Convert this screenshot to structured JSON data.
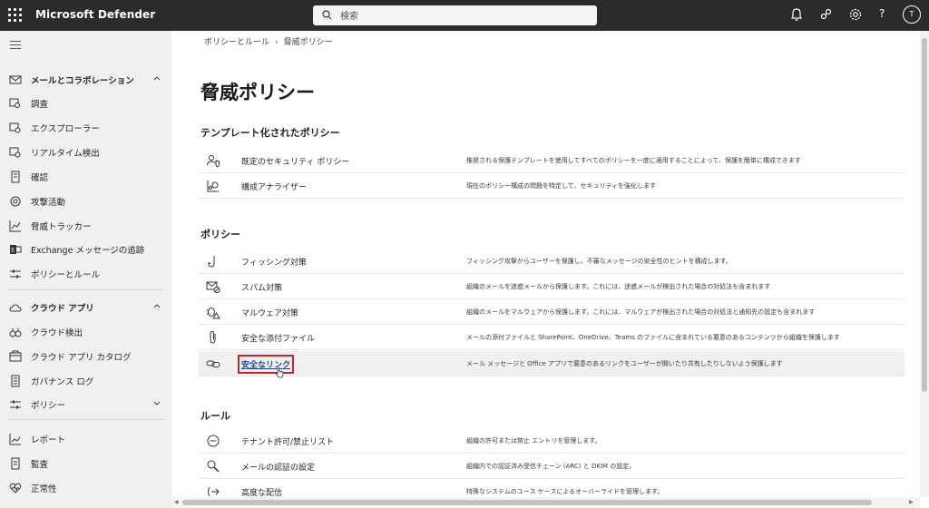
{
  "app": {
    "title": "Microsoft Defender",
    "search_placeholder": "検索",
    "avatar_initial": "T",
    "help_label": "?"
  },
  "sidebar": {
    "groups": [
      {
        "label": "メールとコラボレーション",
        "expanded": true,
        "items": [
          "調査",
          "エクスプローラー",
          "リアルタイム検出",
          "確認",
          "攻撃活動",
          "脅威トラッカー",
          "Exchange メッセージの追跡",
          "ポリシーとルール"
        ]
      },
      {
        "label": "クラウド アプリ",
        "expanded": true,
        "items": [
          "クラウド検出",
          "クラウド アプリ カタログ",
          "ガバナンス ログ",
          "ポリシー"
        ]
      }
    ],
    "bottom_items": [
      "レポート",
      "監査",
      "正常性"
    ]
  },
  "breadcrumb": [
    "ポリシーとルール",
    "脅威ポリシー"
  ],
  "page_title": "脅威ポリシー",
  "sections": [
    {
      "heading": "テンプレート化されたポリシー",
      "rows": [
        {
          "icon": "people-shield-icon",
          "name": "既定のセキュリティ ポリシー",
          "desc": "推奨される保護テンプレートを使用してすべてのポリシーを一度に適用することによって、保護を簡単に構成できます"
        },
        {
          "icon": "analyzer-icon",
          "name": "構成アナライザー",
          "desc": "現在のポリシー構成の問題を特定して、セキュリティを強化します"
        }
      ]
    },
    {
      "heading": "ポリシー",
      "rows": [
        {
          "icon": "fishhook-icon",
          "name": "フィッシング対策",
          "desc": "フィッシング攻撃からユーザーを保護し、不審なメッセージの安全性のヒントを構成します。"
        },
        {
          "icon": "mail-block-icon",
          "name": "スパム対策",
          "desc": "組織のメールを迷惑メールから保護します。これには、迷惑メールが検出された場合の対処法も含まれます"
        },
        {
          "icon": "bug-warning-icon",
          "name": "マルウェア対策",
          "desc": "組織のメールをマルウェアから保護します。これには、マルウェアが検出された場合の対処法と通知先の設定も含まれます"
        },
        {
          "icon": "paperclip-icon",
          "name": "安全な添付ファイル",
          "desc": "メールの添付ファイルと SharePoint、OneDrive、Teams のファイルに含まれている悪意のあるコンテンツから組織を保護します"
        },
        {
          "icon": "link-icon",
          "name": "安全なリンク",
          "desc": "メール メッセージと Office アプリで悪意のあるリンクをユーザーが開いたり共有したりしないよう保護します",
          "highlighted": true
        }
      ]
    },
    {
      "heading": "ルール",
      "rows": [
        {
          "icon": "block-circle-icon",
          "name": "テナント許可/禁止リスト",
          "desc": "組織の許可または禁止 エントリを管理します。"
        },
        {
          "icon": "key-search-icon",
          "name": "メールの認証の設定",
          "desc": "組織内での認証済み受信チェーン (ARC) と DKIM の設定。"
        },
        {
          "icon": "advanced-delivery-icon",
          "name": "高度な配信",
          "desc": "特殊なシステムのユース ケースによるオーバーライドを管理します。"
        }
      ]
    }
  ]
}
